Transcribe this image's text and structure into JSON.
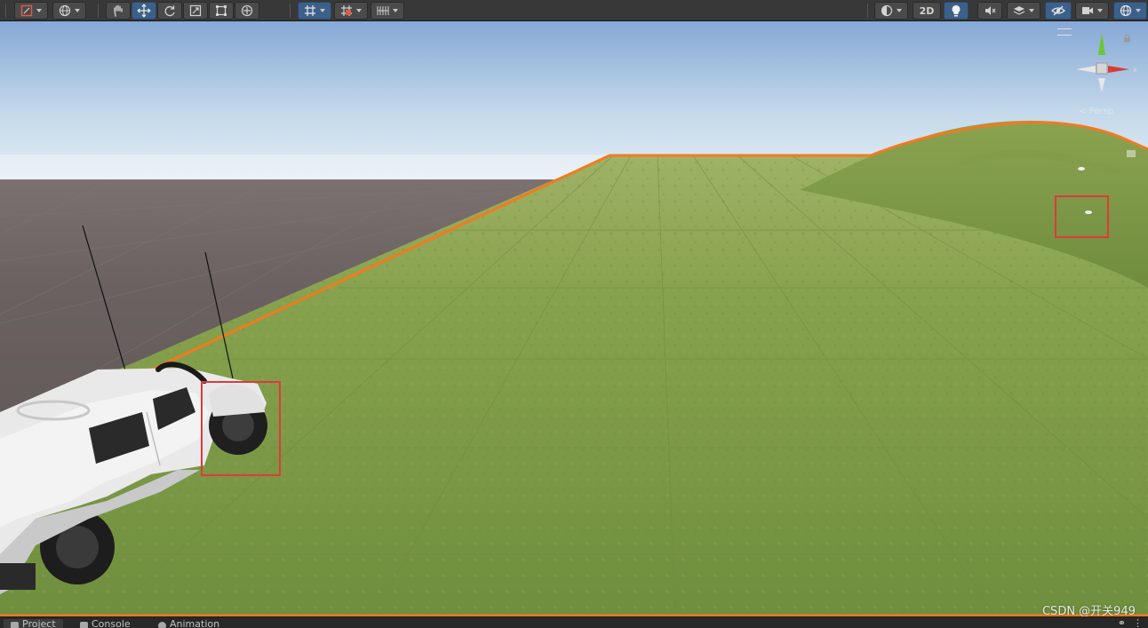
{
  "toolbar": {
    "left_tools": [
      {
        "name": "draw-mode-icon"
      },
      {
        "name": "global-pivot-icon"
      }
    ],
    "transform_tools": [
      {
        "name": "hand-tool-icon",
        "active": false
      },
      {
        "name": "move-tool-icon",
        "active": true
      },
      {
        "name": "rotate-tool-icon",
        "active": false
      },
      {
        "name": "scale-tool-icon",
        "active": false
      },
      {
        "name": "rect-tool-icon",
        "active": false
      },
      {
        "name": "transform-tool-icon",
        "active": false
      }
    ],
    "snap_tools": [
      {
        "name": "grid-snap-icon",
        "active": true
      },
      {
        "name": "increment-snap-icon",
        "active": false
      },
      {
        "name": "grid-visibility-icon",
        "active": false
      }
    ],
    "mode_2d_label": "2D",
    "right_tools": [
      {
        "name": "shading-mode-icon"
      },
      {
        "name": "lighting-icon"
      },
      {
        "name": "audio-icon"
      },
      {
        "name": "effects-icon"
      },
      {
        "name": "scene-visibility-icon"
      },
      {
        "name": "camera-icon"
      },
      {
        "name": "gizmos-icon"
      }
    ]
  },
  "scene": {
    "sky_top": "#86a8d6",
    "sky_horizon": "#e6eff6",
    "ground_dark": "#5f5756",
    "terrain_color": "#7f9a47",
    "selection_outline": "#f27a1f",
    "highlight_color": "#e03a3a",
    "gizmo": {
      "y_axis_color": "#6bc735",
      "x_axis_color": "#dd3a33",
      "z_axis_color": "#e6e6e6",
      "x_label": "x",
      "mode_label": "< Persp"
    },
    "watermark": "CSDN @开关949"
  },
  "bottom_tabs": [
    {
      "label": "Project",
      "icon": "folder-icon",
      "selected": true
    },
    {
      "label": "Console",
      "icon": "console-icon",
      "selected": false
    },
    {
      "label": "Animation",
      "icon": "animation-icon",
      "selected": false
    }
  ]
}
